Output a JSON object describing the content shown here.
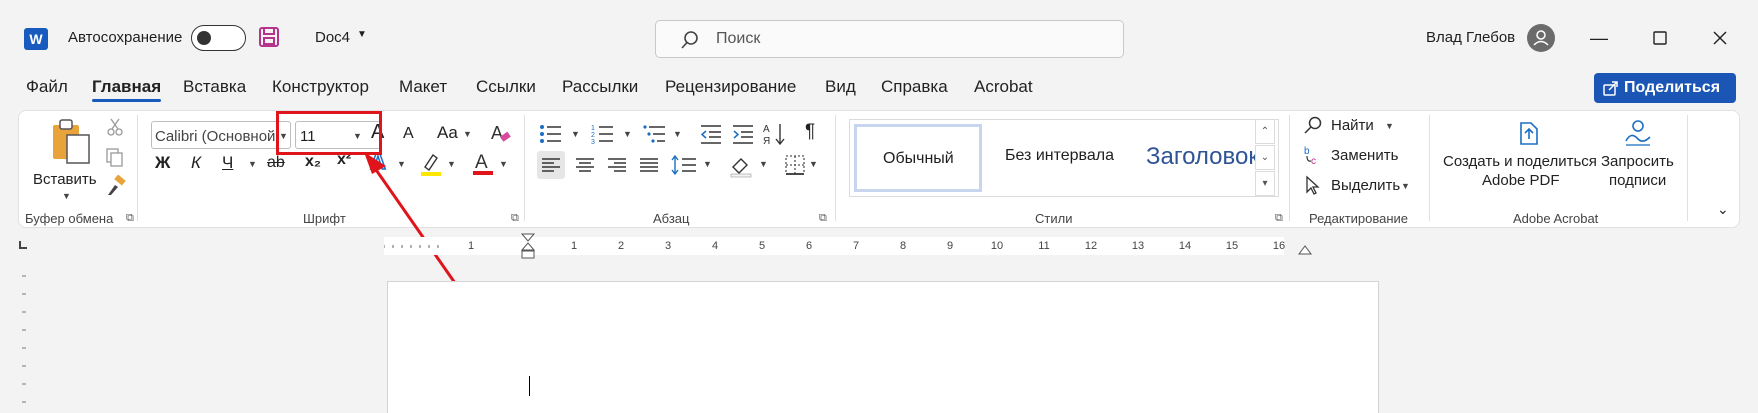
{
  "titlebar": {
    "autosave_label": "Автосохранение",
    "doc_name": "Doc4",
    "search_placeholder": "Поиск",
    "user_name": "Влад Глебов"
  },
  "menu": {
    "tabs": [
      "Файл",
      "Главная",
      "Вставка",
      "Конструктор",
      "Макет",
      "Ссылки",
      "Рассылки",
      "Рецензирование",
      "Вид",
      "Справка",
      "Acrobat"
    ],
    "active_tab": "Главная",
    "share_label": "Поделиться"
  },
  "ribbon": {
    "clipboard": {
      "paste_label": "Вставить",
      "group_label": "Буфер обмена"
    },
    "font": {
      "font_name": "Calibri (Основной",
      "font_size": "11",
      "case_label": "Aa",
      "bold": "Ж",
      "italic": "К",
      "underline": "Ч",
      "strike": "ab",
      "subscript": "x₂",
      "superscript": "x²",
      "font_color_letter": "A",
      "grow_letter": "A",
      "shrink_letter": "A",
      "group_label": "Шрифт"
    },
    "paragraph": {
      "group_label": "Абзац"
    },
    "styles": {
      "items": [
        "Обычный",
        "Без интервала",
        "Заголовок"
      ],
      "group_label": "Стили"
    },
    "editing": {
      "find": "Найти",
      "replace": "Заменить",
      "select": "Выделить",
      "group_label": "Редактирование"
    },
    "acrobat": {
      "create_share_line1": "Создать и поделиться",
      "create_share_line2": "Adobe PDF",
      "request_sign_line1": "Запросить",
      "request_sign_line2": "подписи",
      "group_label": "Adobe Acrobat"
    }
  },
  "ruler": {
    "numbers": [
      "1",
      "1",
      "2",
      "3",
      "4",
      "5",
      "6",
      "7",
      "8",
      "9",
      "10",
      "11",
      "12",
      "13",
      "14",
      "15",
      "16"
    ]
  },
  "colors": {
    "accent": "#185abd",
    "share_button": "#1b56b6",
    "highlight_annotation": "#e0141b",
    "heading_style": "#2f5496"
  }
}
